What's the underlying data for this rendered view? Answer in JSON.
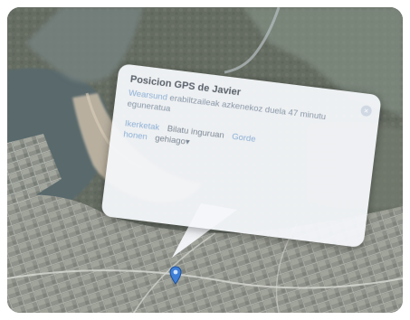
{
  "popup": {
    "title": "Posicion GPS de Javier",
    "description_link": "Wearsund",
    "description_text": "erabiltzaileak azkenekoz duela 47 minutu eguneratua",
    "links": {
      "first": "Ikerketak",
      "second": "Bilatu inguruan",
      "third": "Gorde",
      "fourth_line": "honen",
      "more": "gehiago▾"
    },
    "close_icon": "close-icon"
  },
  "map": {
    "marker_icon": "location-pin-icon"
  },
  "colors": {
    "popup_bg": "#f4f7fa",
    "link": "#8fb1d6",
    "water": "#5c6b6b",
    "land": "#6a6f63",
    "pin": "#3f7fd6"
  }
}
